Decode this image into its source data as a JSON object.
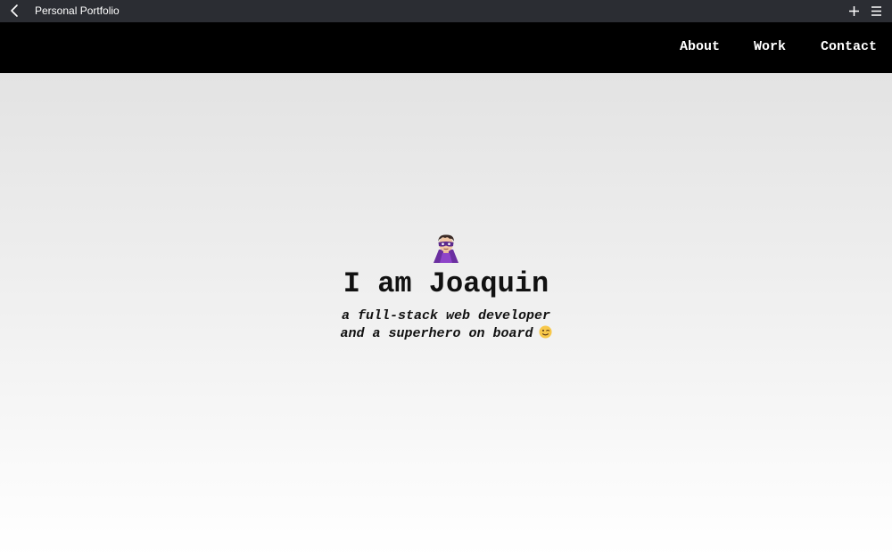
{
  "window": {
    "title": "Personal Portfolio",
    "icons": {
      "back": "chevron-left-icon",
      "new_tab": "plus-icon",
      "menu": "hamburger-menu-icon"
    }
  },
  "nav": {
    "items": [
      {
        "label": "About"
      },
      {
        "label": "Work"
      },
      {
        "label": "Contact"
      }
    ]
  },
  "hero": {
    "avatar_icon": "superhero-emoji-icon",
    "headline": "I am Joaquin",
    "tagline_line1": "a full-stack web developer",
    "tagline_line2": "and a superhero on board",
    "tagline_emoji_icon": "winking-face-emoji-icon"
  },
  "colors": {
    "titlebar_bg": "#2b2d33",
    "navbar_bg": "#000000",
    "hero_gradient_top": "#e3e3e3",
    "hero_gradient_bottom": "#ffffff",
    "text_dark": "#111111",
    "text_light": "#ffffff"
  }
}
